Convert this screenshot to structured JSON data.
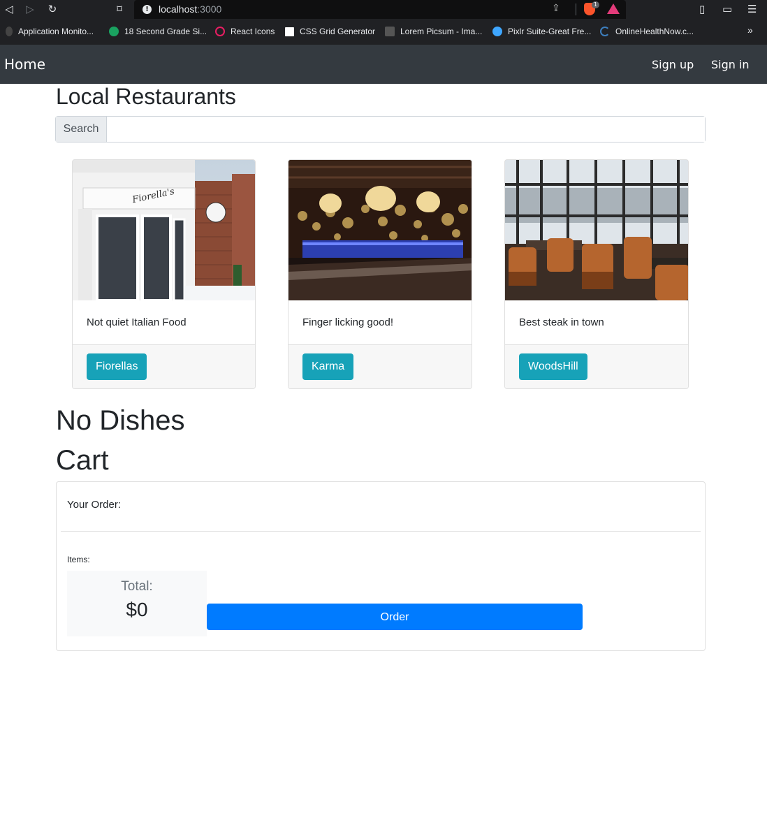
{
  "browser": {
    "url_host": "localhost",
    "url_port": ":3000",
    "brave_badge": "1",
    "bookmarks": [
      {
        "label": "Application Monito...",
        "icon": "monitor-icon",
        "color": "#555555"
      },
      {
        "label": "18 Second Grade Si...",
        "icon": "grade-icon",
        "color": "#1aa260"
      },
      {
        "label": "React Icons",
        "icon": "react-icon",
        "color": "#e91e63"
      },
      {
        "label": "CSS Grid Generator",
        "icon": "grid-icon",
        "color": "#ffffff"
      },
      {
        "label": "Lorem Picsum - Ima...",
        "icon": "picsum-icon",
        "color": "#666666"
      },
      {
        "label": "Pixlr Suite-Great Fre...",
        "icon": "pixlr-icon",
        "color": "#3ea6ff"
      },
      {
        "label": "OnlineHealthNow.c...",
        "icon": "health-icon",
        "color": "#3d7fbf"
      }
    ],
    "more_bookmarks": "»"
  },
  "navbar": {
    "home": "Home",
    "signup": "Sign up",
    "signin": "Sign in"
  },
  "page": {
    "title": "Local Restaurants",
    "search_label": "Search",
    "search_value": "",
    "no_dishes": "No Dishes",
    "cart_heading": "Cart"
  },
  "restaurants": [
    {
      "description": "Not quiet Italian Food",
      "button": "Fiorellas",
      "sign": "Fiorella's"
    },
    {
      "description": "Finger licking good!",
      "button": "Karma"
    },
    {
      "description": "Best steak in town",
      "button": "WoodsHill"
    }
  ],
  "cart": {
    "your_order": "Your Order:",
    "items_label": "Items:",
    "total_label": "Total:",
    "total_value": "$0",
    "order_button": "Order"
  },
  "colors": {
    "navbar_bg": "#343a40",
    "card_button": "#17a2b8",
    "order_button": "#007bff"
  }
}
